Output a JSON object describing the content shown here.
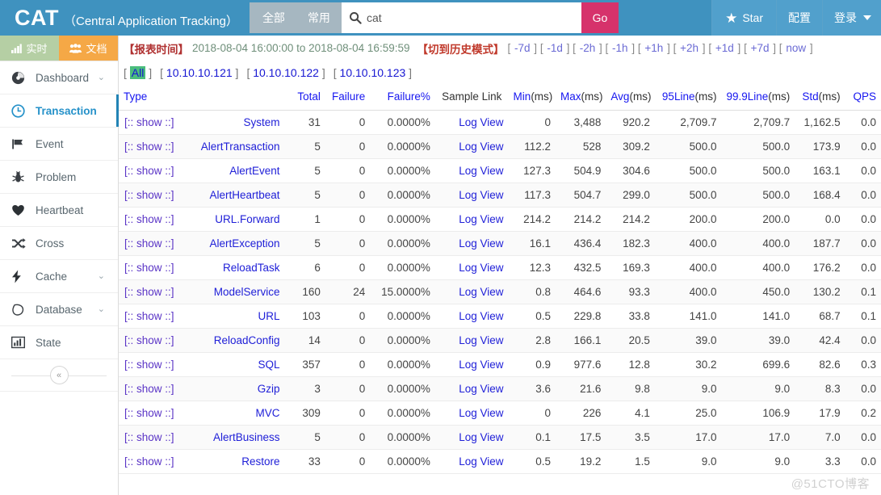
{
  "topbar": {
    "brand_short": "CAT",
    "brand_full": "（Central Application Tracking）",
    "seg_all": "全部",
    "seg_common": "常用",
    "search_value": "cat",
    "search_placeholder": "cat",
    "go_label": "Go",
    "star_label": "Star",
    "config_label": "配置",
    "login_label": "登录",
    "bg_color": "#3f92bf",
    "go_color": "#d6326b"
  },
  "modebar": {
    "realtime_label": "实时",
    "doc_label": "文档",
    "realtime_color": "#b5cfa4",
    "doc_color": "#f5a846"
  },
  "sidebar": {
    "items": [
      {
        "label": "Dashboard",
        "icon": "dashboard-icon",
        "chevron": "⌄",
        "active": false
      },
      {
        "label": "Transaction",
        "icon": "clock-icon",
        "chevron": "",
        "active": true
      },
      {
        "label": "Event",
        "icon": "flag-icon",
        "chevron": "",
        "active": false
      },
      {
        "label": "Problem",
        "icon": "bug-icon",
        "chevron": "",
        "active": false
      },
      {
        "label": "Heartbeat",
        "icon": "heart-icon",
        "chevron": "",
        "active": false
      },
      {
        "label": "Cross",
        "icon": "shuffle-icon",
        "chevron": "",
        "active": false
      },
      {
        "label": "Cache",
        "icon": "bolt-icon",
        "chevron": "⌄",
        "active": false
      },
      {
        "label": "Database",
        "icon": "database-icon",
        "chevron": "⌄",
        "active": false
      },
      {
        "label": "State",
        "icon": "bar-chart-icon",
        "chevron": "",
        "active": false
      }
    ],
    "collapse_label": "«"
  },
  "info": {
    "report_time_label": "【报表时间】",
    "time_range": "2018-08-04 16:00:00 to 2018-08-04 16:59:59",
    "history_mode": "【切到历史模式】",
    "shifts": [
      "-7d",
      "-1d",
      "-2h",
      "-1h",
      "+1h",
      "+2h",
      "+1d",
      "+7d",
      "now"
    ]
  },
  "ipfilter": {
    "items": [
      "All",
      "10.10.10.121",
      "10.10.10.122",
      "10.10.10.123"
    ],
    "selected": "All",
    "highlight_color": "#4bbd7d"
  },
  "table": {
    "columns": [
      {
        "key": "show",
        "label": ""
      },
      {
        "key": "type",
        "label": "Type"
      },
      {
        "key": "total",
        "label": "Total"
      },
      {
        "key": "failure",
        "label": "Failure"
      },
      {
        "key": "failurep",
        "label": "Failure%"
      },
      {
        "key": "sample",
        "label": "Sample Link"
      },
      {
        "key": "min",
        "label": "Min",
        "unit": "(ms)"
      },
      {
        "key": "max",
        "label": "Max",
        "unit": "(ms)"
      },
      {
        "key": "avg",
        "label": "Avg",
        "unit": "(ms)"
      },
      {
        "key": "l95",
        "label": "95Line",
        "unit": "(ms)"
      },
      {
        "key": "l999",
        "label": "99.9Line",
        "unit": "(ms)"
      },
      {
        "key": "std",
        "label": "Std",
        "unit": "(ms)"
      },
      {
        "key": "qps",
        "label": "QPS"
      }
    ],
    "show_label": "[:: show ::]",
    "log_label": "Log View",
    "rows": [
      {
        "type": "System",
        "total": "31",
        "failure": "0",
        "failurep": "0.0000%",
        "min": "0",
        "max": "3,488",
        "avg": "920.2",
        "l95": "2,709.7",
        "l999": "2,709.7",
        "std": "1,162.5",
        "qps": "0.0"
      },
      {
        "type": "AlertTransaction",
        "total": "5",
        "failure": "0",
        "failurep": "0.0000%",
        "min": "112.2",
        "max": "528",
        "avg": "309.2",
        "l95": "500.0",
        "l999": "500.0",
        "std": "173.9",
        "qps": "0.0"
      },
      {
        "type": "AlertEvent",
        "total": "5",
        "failure": "0",
        "failurep": "0.0000%",
        "min": "127.3",
        "max": "504.9",
        "avg": "304.6",
        "l95": "500.0",
        "l999": "500.0",
        "std": "163.1",
        "qps": "0.0"
      },
      {
        "type": "AlertHeartbeat",
        "total": "5",
        "failure": "0",
        "failurep": "0.0000%",
        "min": "117.3",
        "max": "504.7",
        "avg": "299.0",
        "l95": "500.0",
        "l999": "500.0",
        "std": "168.4",
        "qps": "0.0"
      },
      {
        "type": "URL.Forward",
        "total": "1",
        "failure": "0",
        "failurep": "0.0000%",
        "min": "214.2",
        "max": "214.2",
        "avg": "214.2",
        "l95": "200.0",
        "l999": "200.0",
        "std": "0.0",
        "qps": "0.0"
      },
      {
        "type": "AlertException",
        "total": "5",
        "failure": "0",
        "failurep": "0.0000%",
        "min": "16.1",
        "max": "436.4",
        "avg": "182.3",
        "l95": "400.0",
        "l999": "400.0",
        "std": "187.7",
        "qps": "0.0"
      },
      {
        "type": "ReloadTask",
        "total": "6",
        "failure": "0",
        "failurep": "0.0000%",
        "min": "12.3",
        "max": "432.5",
        "avg": "169.3",
        "l95": "400.0",
        "l999": "400.0",
        "std": "176.2",
        "qps": "0.0"
      },
      {
        "type": "ModelService",
        "total": "160",
        "failure": "24",
        "failurep": "15.0000%",
        "min": "0.8",
        "max": "464.6",
        "avg": "93.3",
        "l95": "400.0",
        "l999": "450.0",
        "std": "130.2",
        "qps": "0.1"
      },
      {
        "type": "URL",
        "total": "103",
        "failure": "0",
        "failurep": "0.0000%",
        "min": "0.5",
        "max": "229.8",
        "avg": "33.8",
        "l95": "141.0",
        "l999": "141.0",
        "std": "68.7",
        "qps": "0.1"
      },
      {
        "type": "ReloadConfig",
        "total": "14",
        "failure": "0",
        "failurep": "0.0000%",
        "min": "2.8",
        "max": "166.1",
        "avg": "20.5",
        "l95": "39.0",
        "l999": "39.0",
        "std": "42.4",
        "qps": "0.0"
      },
      {
        "type": "SQL",
        "total": "357",
        "failure": "0",
        "failurep": "0.0000%",
        "min": "0.9",
        "max": "977.6",
        "avg": "12.8",
        "l95": "30.2",
        "l999": "699.6",
        "std": "82.6",
        "qps": "0.3"
      },
      {
        "type": "Gzip",
        "total": "3",
        "failure": "0",
        "failurep": "0.0000%",
        "min": "3.6",
        "max": "21.6",
        "avg": "9.8",
        "l95": "9.0",
        "l999": "9.0",
        "std": "8.3",
        "qps": "0.0"
      },
      {
        "type": "MVC",
        "total": "309",
        "failure": "0",
        "failurep": "0.0000%",
        "min": "0",
        "max": "226",
        "avg": "4.1",
        "l95": "25.0",
        "l999": "106.9",
        "std": "17.9",
        "qps": "0.2"
      },
      {
        "type": "AlertBusiness",
        "total": "5",
        "failure": "0",
        "failurep": "0.0000%",
        "min": "0.1",
        "max": "17.5",
        "avg": "3.5",
        "l95": "17.0",
        "l999": "17.0",
        "std": "7.0",
        "qps": "0.0"
      },
      {
        "type": "Restore",
        "total": "33",
        "failure": "0",
        "failurep": "0.0000%",
        "min": "0.5",
        "max": "19.2",
        "avg": "1.5",
        "l95": "9.0",
        "l999": "9.0",
        "std": "3.3",
        "qps": "0.0"
      }
    ]
  },
  "watermark": "@51CTO博客"
}
